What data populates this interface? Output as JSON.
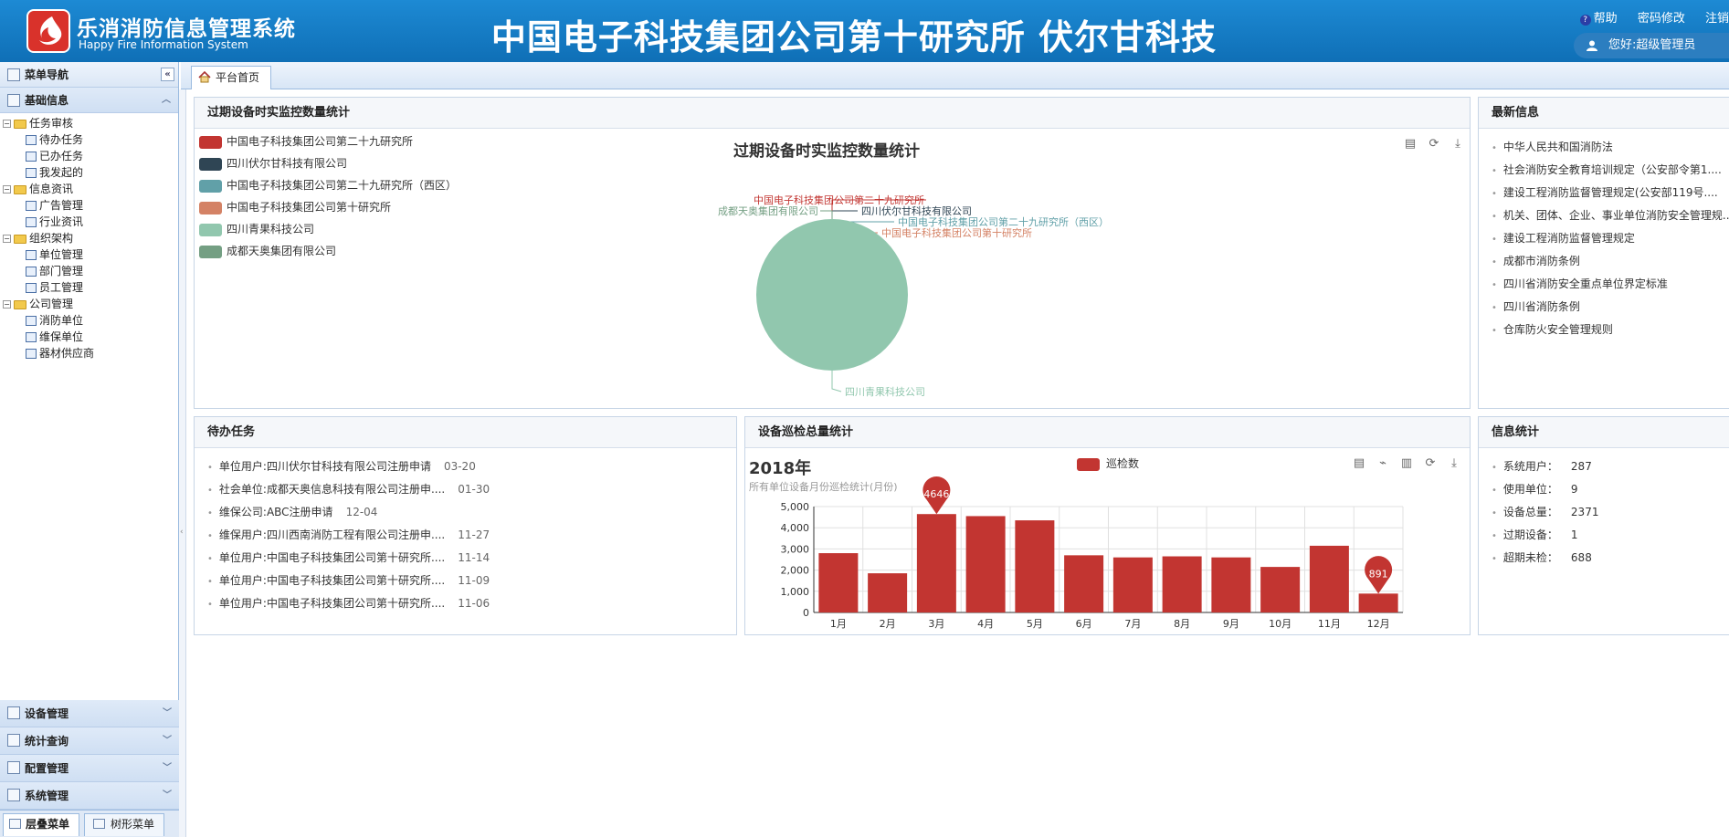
{
  "header": {
    "app_name": "乐消消防信息管理系统",
    "app_name_en": "Happy Fire Information System",
    "org_title": "中国电子科技集团公司第十研究所 伏尔甘科技",
    "help": "帮助",
    "change_password": "密码修改",
    "logout": "注销",
    "greeting": "您好:超级管理员"
  },
  "sidebar": {
    "title": "菜单导航",
    "collapse": "«",
    "section_basic": "基础信息",
    "tree": [
      {
        "label": "任务审核",
        "level": 0,
        "type": "folder"
      },
      {
        "label": "待办任务",
        "level": 1,
        "type": "leaf"
      },
      {
        "label": "已办任务",
        "level": 1,
        "type": "leaf"
      },
      {
        "label": "我发起的",
        "level": 1,
        "type": "leaf"
      },
      {
        "label": "信息资讯",
        "level": 0,
        "type": "folder"
      },
      {
        "label": "广告管理",
        "level": 1,
        "type": "leaf"
      },
      {
        "label": "行业资讯",
        "level": 1,
        "type": "leaf"
      },
      {
        "label": "组织架构",
        "level": 0,
        "type": "folder"
      },
      {
        "label": "单位管理",
        "level": 1,
        "type": "leaf"
      },
      {
        "label": "部门管理",
        "level": 1,
        "type": "leaf"
      },
      {
        "label": "员工管理",
        "level": 1,
        "type": "leaf"
      },
      {
        "label": "公司管理",
        "level": 0,
        "type": "folder"
      },
      {
        "label": "消防单位",
        "level": 1,
        "type": "leaf"
      },
      {
        "label": "维保单位",
        "level": 1,
        "type": "leaf"
      },
      {
        "label": "器材供应商",
        "level": 1,
        "type": "leaf"
      }
    ],
    "bottom_sections": [
      "设备管理",
      "统计查询",
      "配置管理",
      "系统管理"
    ],
    "tab_layered": "层叠菜单",
    "tab_tree": "树形菜单"
  },
  "tabbar": {
    "home_tab": "平台首页"
  },
  "expired_panel": {
    "title": "过期设备时实监控数量统计",
    "chart_title": "过期设备时实监控数量统计"
  },
  "news_panel": {
    "title": "最新信息",
    "items": [
      "中华人民共和国消防法",
      "社会消防安全教育培训规定（公安部令第1....",
      "建设工程消防监督管理规定(公安部119号....",
      "机关、团体、企业、事业单位消防安全管理规...",
      "建设工程消防监督管理规定",
      "成都市消防条例",
      "四川省消防安全重点单位界定标准",
      "四川省消防条例",
      "仓库防火安全管理规则"
    ]
  },
  "todo_panel": {
    "title": "待办任务",
    "items": [
      {
        "text": "单位用户:四川伏尔甘科技有限公司注册申请",
        "date": "03-20"
      },
      {
        "text": "社会单位:成都天奥信息科技有限公司注册申....",
        "date": "01-30"
      },
      {
        "text": "维保公司:ABC注册申请",
        "date": "12-04"
      },
      {
        "text": "维保用户:四川西南消防工程有限公司注册申....",
        "date": "11-27"
      },
      {
        "text": "单位用户:中国电子科技集团公司第十研究所....",
        "date": "11-14"
      },
      {
        "text": "单位用户:中国电子科技集团公司第十研究所....",
        "date": "11-09"
      },
      {
        "text": "单位用户:中国电子科技集团公司第十研究所....",
        "date": "11-06"
      }
    ]
  },
  "patrol_panel": {
    "title": "设备巡检总量统计",
    "year": "2018年",
    "subtitle": "所有单位设备月份巡检统计(月份)",
    "legend": "巡检数"
  },
  "stats_panel": {
    "title": "信息统计",
    "items": [
      {
        "label": "系统用户：",
        "value": "287"
      },
      {
        "label": "使用单位：",
        "value": "9"
      },
      {
        "label": "设备总量：",
        "value": "2371"
      },
      {
        "label": "过期设备：",
        "value": "1"
      },
      {
        "label": "超期未检：",
        "value": "688"
      }
    ]
  },
  "chart_data": [
    {
      "type": "pie",
      "title": "过期设备时实监控数量统计",
      "categories": [
        "中国电子科技集团公司第二十九研究所",
        "四川伏尔甘科技有限公司",
        "中国电子科技集团公司第二十九研究所（西区）",
        "中国电子科技集团公司第十研究所",
        "四川青果科技公司",
        "成都天奥集团有限公司"
      ],
      "values": [
        0,
        0,
        0,
        0,
        1,
        0
      ],
      "colors": [
        "#c23531",
        "#2f4554",
        "#61a0a8",
        "#d48265",
        "#91c7ae",
        "#749f83"
      ],
      "legend": "top-left"
    },
    {
      "type": "bar",
      "title": "2018年",
      "subtitle": "所有单位设备月份巡检统计(月份)",
      "categories": [
        "1月",
        "2月",
        "3月",
        "4月",
        "5月",
        "6月",
        "7月",
        "8月",
        "9月",
        "10月",
        "11月",
        "12月"
      ],
      "series": [
        {
          "name": "巡检数",
          "values": [
            2800,
            1850,
            4646,
            4550,
            4350,
            2700,
            2600,
            2650,
            2600,
            2150,
            3150,
            891
          ],
          "color": "#c23531"
        }
      ],
      "markers": [
        {
          "label": "4646",
          "index": 2
        },
        {
          "label": "891",
          "index": 11
        }
      ],
      "yticks": [
        "0",
        "1,000",
        "2,000",
        "3,000",
        "4,000",
        "5,000"
      ],
      "ylim": [
        0,
        5000
      ],
      "grid": true,
      "legend": "top"
    }
  ]
}
